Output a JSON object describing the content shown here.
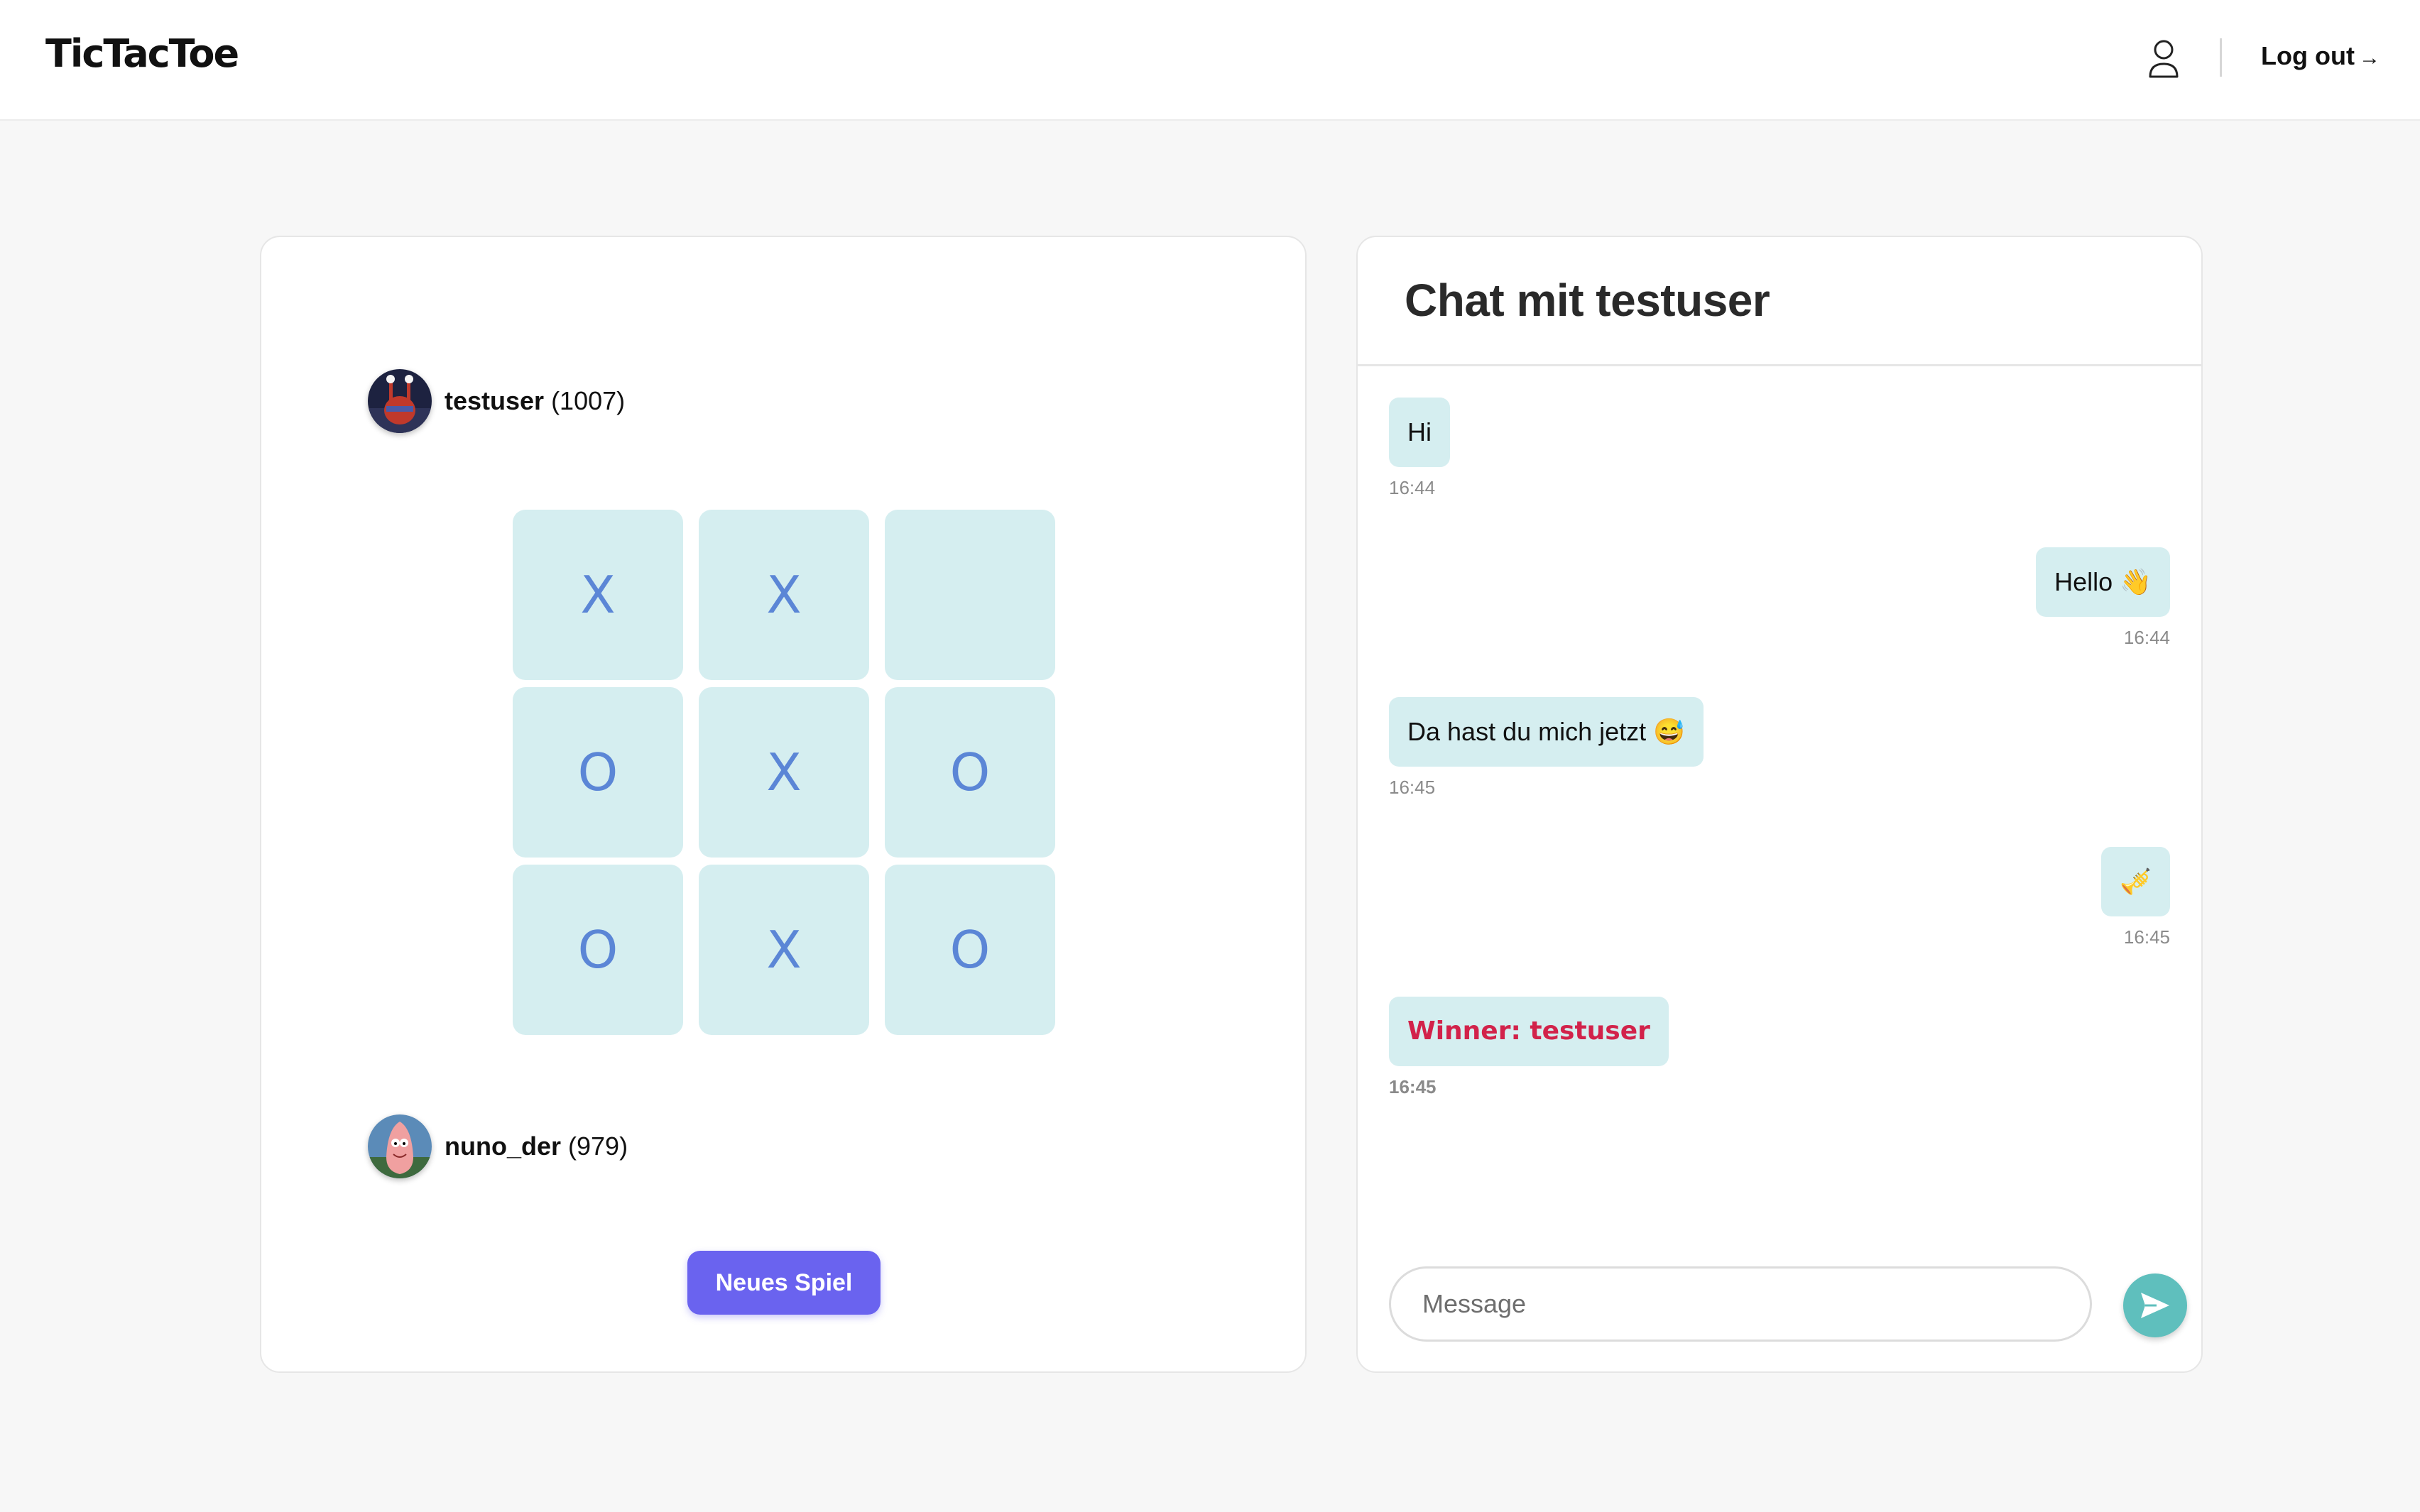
{
  "header": {
    "logo": "TicTacToe",
    "logout_label": "Log out",
    "logout_arrow": "→"
  },
  "game": {
    "players": [
      {
        "name": "testuser",
        "rating": "(1007)",
        "avatar": "crab-avatar"
      },
      {
        "name": "nuno_der",
        "rating": "(979)",
        "avatar": "starfish-avatar"
      }
    ],
    "board": [
      "X",
      "X",
      "",
      "O",
      "X",
      "O",
      "O",
      "X",
      "O"
    ],
    "new_game_label": "Neues Spiel"
  },
  "chat": {
    "title": "Chat mit testuser",
    "messages": [
      {
        "text": "Hi",
        "time": "16:44",
        "side": "left"
      },
      {
        "text": "Hello 👋",
        "time": "16:44",
        "side": "right"
      },
      {
        "text": "Da hast du mich jetzt 😅",
        "time": "16:45",
        "side": "left"
      },
      {
        "text": "🎺",
        "time": "16:45",
        "side": "right"
      },
      {
        "text": "Winner: testuser",
        "time": "16:45",
        "side": "left",
        "type": "winner"
      }
    ],
    "input_placeholder": "Message"
  },
  "colors": {
    "accent": "#6a63ef",
    "cell_bg": "#d5eef0",
    "mark": "#5b86d6",
    "winner": "#d2224a",
    "send": "#5fbfbd"
  }
}
